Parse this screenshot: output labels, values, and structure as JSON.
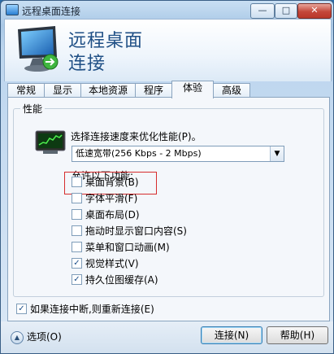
{
  "window": {
    "title": "远程桌面连接",
    "controls": {
      "minimize": "—",
      "maximize": "□",
      "close": "✕"
    }
  },
  "header": {
    "line1": "远程桌面",
    "line2": "连接"
  },
  "tabs": [
    {
      "label": "常规"
    },
    {
      "label": "显示"
    },
    {
      "label": "本地资源"
    },
    {
      "label": "程序"
    },
    {
      "label": "体验",
      "active": true
    },
    {
      "label": "高级"
    }
  ],
  "performance": {
    "group_title": "性能",
    "speed_label": "选择连接速度来优化性能(P)。",
    "speed_selected": "低速宽带(256 Kbps - 2 Mbps)",
    "allow_label": "允许以下功能:",
    "options": [
      {
        "label": "桌面背景(B)",
        "checked": false
      },
      {
        "label": "字体平滑(F)",
        "checked": false
      },
      {
        "label": "桌面布局(D)",
        "checked": false
      },
      {
        "label": "拖动时显示窗口内容(S)",
        "checked": false
      },
      {
        "label": "菜单和窗口动画(M)",
        "checked": false
      },
      {
        "label": "视觉样式(V)",
        "checked": true
      },
      {
        "label": "持久位图缓存(A)",
        "checked": true
      }
    ]
  },
  "reconnect": {
    "label": "如果连接中断,则重新连接(E)",
    "checked": true
  },
  "footer": {
    "options_label": "选项(O)",
    "connect_label": "连接(N)",
    "help_label": "帮助(H)"
  },
  "colors": {
    "highlight_box": "#d62d2d",
    "header_text": "#1f4f85"
  },
  "icons": {
    "app": "remote-desktop-icon",
    "monitor": "monitor-icon",
    "speed": "speed-meter-icon"
  }
}
